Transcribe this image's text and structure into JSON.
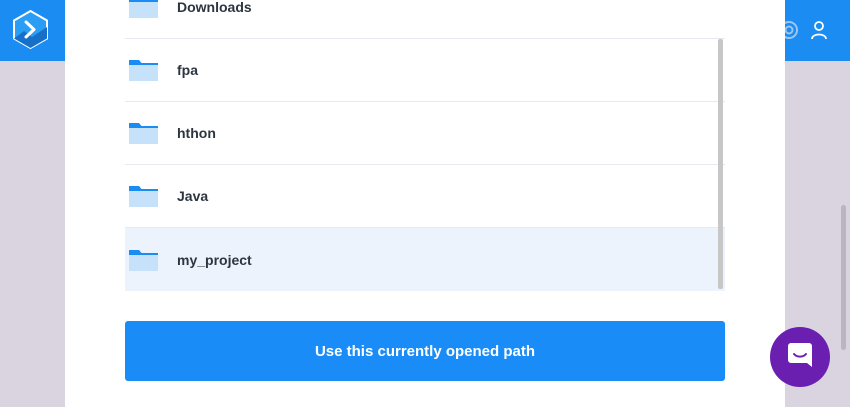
{
  "folders": [
    {
      "name": "Downloads",
      "selected": false
    },
    {
      "name": "fpa",
      "selected": false
    },
    {
      "name": "hthon",
      "selected": false
    },
    {
      "name": "Java",
      "selected": false
    },
    {
      "name": "my_project",
      "selected": true
    }
  ],
  "actions": {
    "use_path_label": "Use this currently opened path"
  },
  "header": {
    "logo_icon": "chevron-right-logo-icon",
    "right_icons": [
      "help-icon",
      "user-icon"
    ]
  },
  "chat": {
    "icon": "chat-bubble-icon"
  },
  "colors": {
    "header": "#1a8cf2",
    "primary_button": "#1a8cf7",
    "selected_row": "#edf3fc",
    "folder_icon": "#1a8cf2",
    "chat_launcher": "#6b1fb1",
    "backdrop": "#d9d4df"
  }
}
